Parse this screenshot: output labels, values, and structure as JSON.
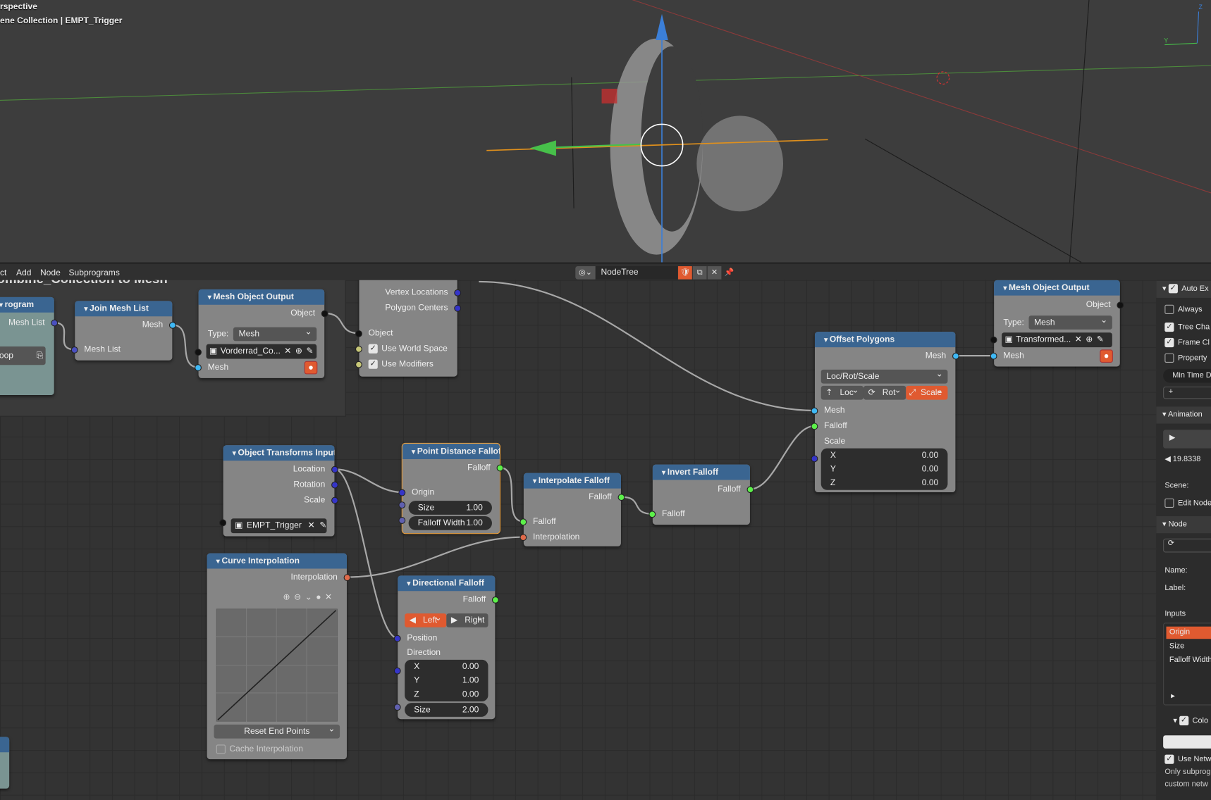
{
  "viewport": {
    "view_name": "rspective",
    "collection_path": "ene Collection | EMPT_Trigger"
  },
  "editor": {
    "menu": [
      "ct",
      "Add",
      "Node",
      "Subprograms"
    ],
    "tree_name": "NodeTree",
    "frame_title": "ombine_Collection to Mesh"
  },
  "colors": {
    "header": "#3a6591",
    "mesh_socket": "#3fb9f6",
    "falloff_socket": "#5cf04a",
    "vector_socket": "#3535c8",
    "interp_socket": "#e06a4a",
    "bool_socket": "#c8c878",
    "accent": "#e05a30"
  },
  "nodes": {
    "program": {
      "title": "rogram",
      "out": "Mesh List",
      "field": "oop"
    },
    "join": {
      "title": "Join Mesh List",
      "out": "Mesh",
      "in": "Mesh List"
    },
    "moo1": {
      "title": "Mesh Object Output",
      "out": "Object",
      "type_label": "Type:",
      "type": "Mesh",
      "object": "Vorderrad_Co...",
      "in": "Mesh"
    },
    "verts": {
      "out1": "Vertex Locations",
      "out2": "Polygon Centers",
      "in": "Object",
      "opt1": "Use World Space",
      "opt2": "Use Modifiers"
    },
    "oti": {
      "title": "Object Transforms Input",
      "out1": "Location",
      "out2": "Rotation",
      "out3": "Scale",
      "object": "EMPT_Trigger"
    },
    "pdf": {
      "title": "Point Distance Falloff",
      "out": "Falloff",
      "in": "Origin",
      "size_label": "Size",
      "size": "1.00",
      "fw_label": "Falloff Width",
      "fw": "1.00"
    },
    "curve": {
      "title": "Curve Interpolation",
      "out": "Interpolation",
      "reset": "Reset End Points",
      "cache": "Cache Interpolation"
    },
    "dir": {
      "title": "Directional Falloff",
      "out": "Falloff",
      "left": "Left",
      "right": "Right",
      "in": "Position",
      "dir_label": "Direction",
      "x": "0.00",
      "y": "1.00",
      "z": "0.00",
      "size_label": "Size",
      "size": "2.00"
    },
    "interp": {
      "title": "Interpolate Falloff",
      "out": "Falloff",
      "in1": "Falloff",
      "in2": "Interpolation"
    },
    "invert": {
      "title": "Invert Falloff",
      "out": "Falloff",
      "in": "Falloff"
    },
    "offset": {
      "title": "Offset Polygons",
      "out": "Mesh",
      "mode": "Loc/Rot/Scale",
      "loc": "Loc",
      "rot": "Rot",
      "scale": "Scale",
      "in1": "Mesh",
      "in2": "Falloff",
      "scale_label": "Scale",
      "x": "0.00",
      "y": "0.00",
      "z": "0.00"
    },
    "moo2": {
      "title": "Mesh Object Output",
      "out": "Object",
      "type_label": "Type:",
      "type": "Mesh",
      "object": "Transformed...",
      "in": "Mesh"
    }
  },
  "axes": {
    "x": "X",
    "y": "Y",
    "z": "Z"
  },
  "sidebar": {
    "auto": "Auto Ex",
    "always": "Always",
    "tree": "Tree Cha",
    "frame": "Frame Cl",
    "property": "Property",
    "min_time": "Min Time D",
    "add": "+",
    "animation": "Animation",
    "time": "19.8338",
    "scene": "Scene:",
    "edit_node": "Edit Node",
    "node": "Node",
    "name": "Name:",
    "label": "Label:",
    "inputs": "Inputs",
    "inputs_list": [
      "Origin",
      "Size",
      "Falloff Width"
    ],
    "color": "Colo",
    "use_net": "Use Netw",
    "note1": "Only subprog",
    "note2": "custom netw"
  }
}
